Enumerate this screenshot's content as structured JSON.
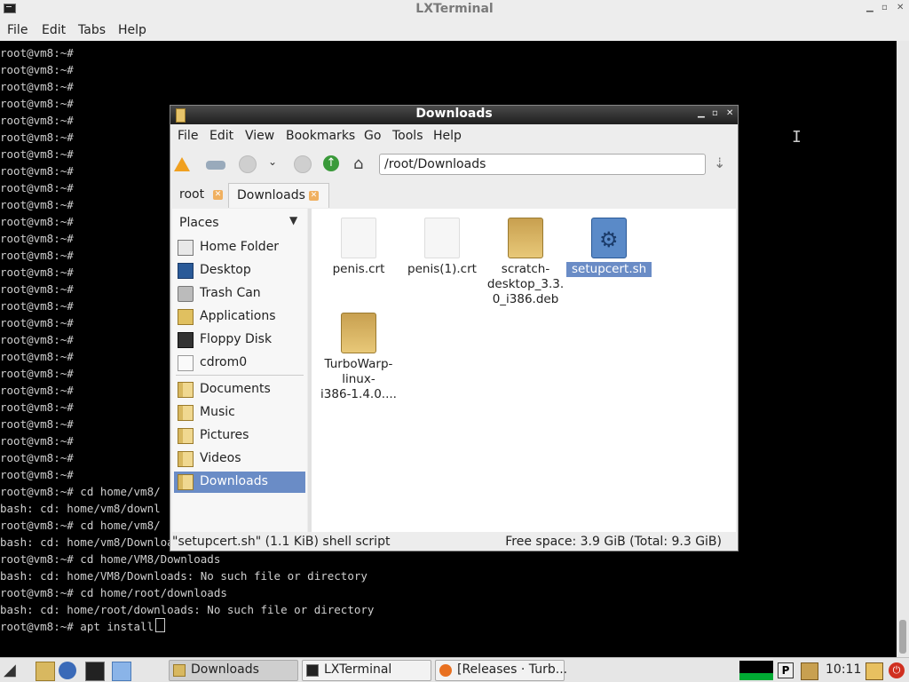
{
  "terminal": {
    "title": "LXTerminal",
    "menu": [
      "File",
      "Edit",
      "Tabs",
      "Help"
    ],
    "lines": [
      "root@vm8:~#",
      "root@vm8:~#",
      "root@vm8:~#",
      "root@vm8:~#",
      "root@vm8:~#",
      "root@vm8:~#",
      "root@vm8:~#",
      "root@vm8:~#",
      "root@vm8:~#",
      "root@vm8:~#",
      "root@vm8:~#",
      "root@vm8:~#",
      "root@vm8:~#",
      "root@vm8:~#",
      "root@vm8:~#",
      "root@vm8:~#",
      "root@vm8:~#",
      "root@vm8:~#",
      "root@vm8:~#",
      "root@vm8:~#",
      "root@vm8:~#",
      "root@vm8:~#",
      "root@vm8:~#",
      "root@vm8:~#",
      "root@vm8:~#",
      "root@vm8:~#",
      "root@vm8:~# cd home/vm8/",
      "bash: cd: home/vm8/downl",
      "root@vm8:~# cd home/vm8/",
      "bash: cd: home/vm8/Downloads: No such file or directory",
      "root@vm8:~# cd home/VM8/Downloads",
      "bash: cd: home/VM8/Downloads: No such file or directory",
      "root@vm8:~# cd home/root/downloads",
      "bash: cd: home/root/downloads: No such file or directory",
      "root@vm8:~# apt install"
    ]
  },
  "filemanager": {
    "title": "Downloads",
    "menu": [
      "File",
      "Edit",
      "View",
      "Bookmarks",
      "Go",
      "Tools",
      "Help"
    ],
    "path": "/root/Downloads",
    "tabs": [
      {
        "label": "root",
        "active": false
      },
      {
        "label": "Downloads",
        "active": true
      }
    ],
    "places_title": "Places",
    "places": [
      {
        "label": "Home Folder",
        "icon": "home-folder-icon"
      },
      {
        "label": "Desktop",
        "icon": "desktop-icon"
      },
      {
        "label": "Trash Can",
        "icon": "trash-icon"
      },
      {
        "label": "Applications",
        "icon": "applications-icon"
      },
      {
        "label": "Floppy Disk",
        "icon": "floppy-icon"
      },
      {
        "label": "cdrom0",
        "icon": "cdrom-icon"
      }
    ],
    "bookmarks": [
      {
        "label": "Documents",
        "icon": "folder-icon"
      },
      {
        "label": "Music",
        "icon": "folder-icon"
      },
      {
        "label": "Pictures",
        "icon": "folder-icon"
      },
      {
        "label": "Videos",
        "icon": "folder-icon"
      },
      {
        "label": "Downloads",
        "icon": "folder-icon",
        "selected": true
      }
    ],
    "files": [
      {
        "name": "penis.crt",
        "type": "document"
      },
      {
        "name": "penis(1).crt",
        "type": "document"
      },
      {
        "name": "scratch-desktop_3.3.0_i386.deb",
        "display": [
          "scratch-",
          "desktop_3.3.",
          "0_i386.deb"
        ],
        "type": "package"
      },
      {
        "name": "setupcert.sh",
        "type": "script",
        "selected": true
      },
      {
        "name": "TurboWarp-linux-i386-1.4.0....",
        "display": [
          "TurboWarp-",
          "linux-",
          "i386-1.4.0...."
        ],
        "type": "package"
      }
    ],
    "status_left": "\"setupcert.sh\" (1.1 KiB) shell script",
    "status_right": "Free space: 3.9 GiB (Total: 9.3 GiB)"
  },
  "taskbar": {
    "tasks": [
      {
        "label": "Downloads",
        "active": true
      },
      {
        "label": "LXTerminal",
        "active": false
      },
      {
        "label": "[Releases · Turb...",
        "active": false
      }
    ],
    "tray_p": "P",
    "clock": "10:11"
  }
}
